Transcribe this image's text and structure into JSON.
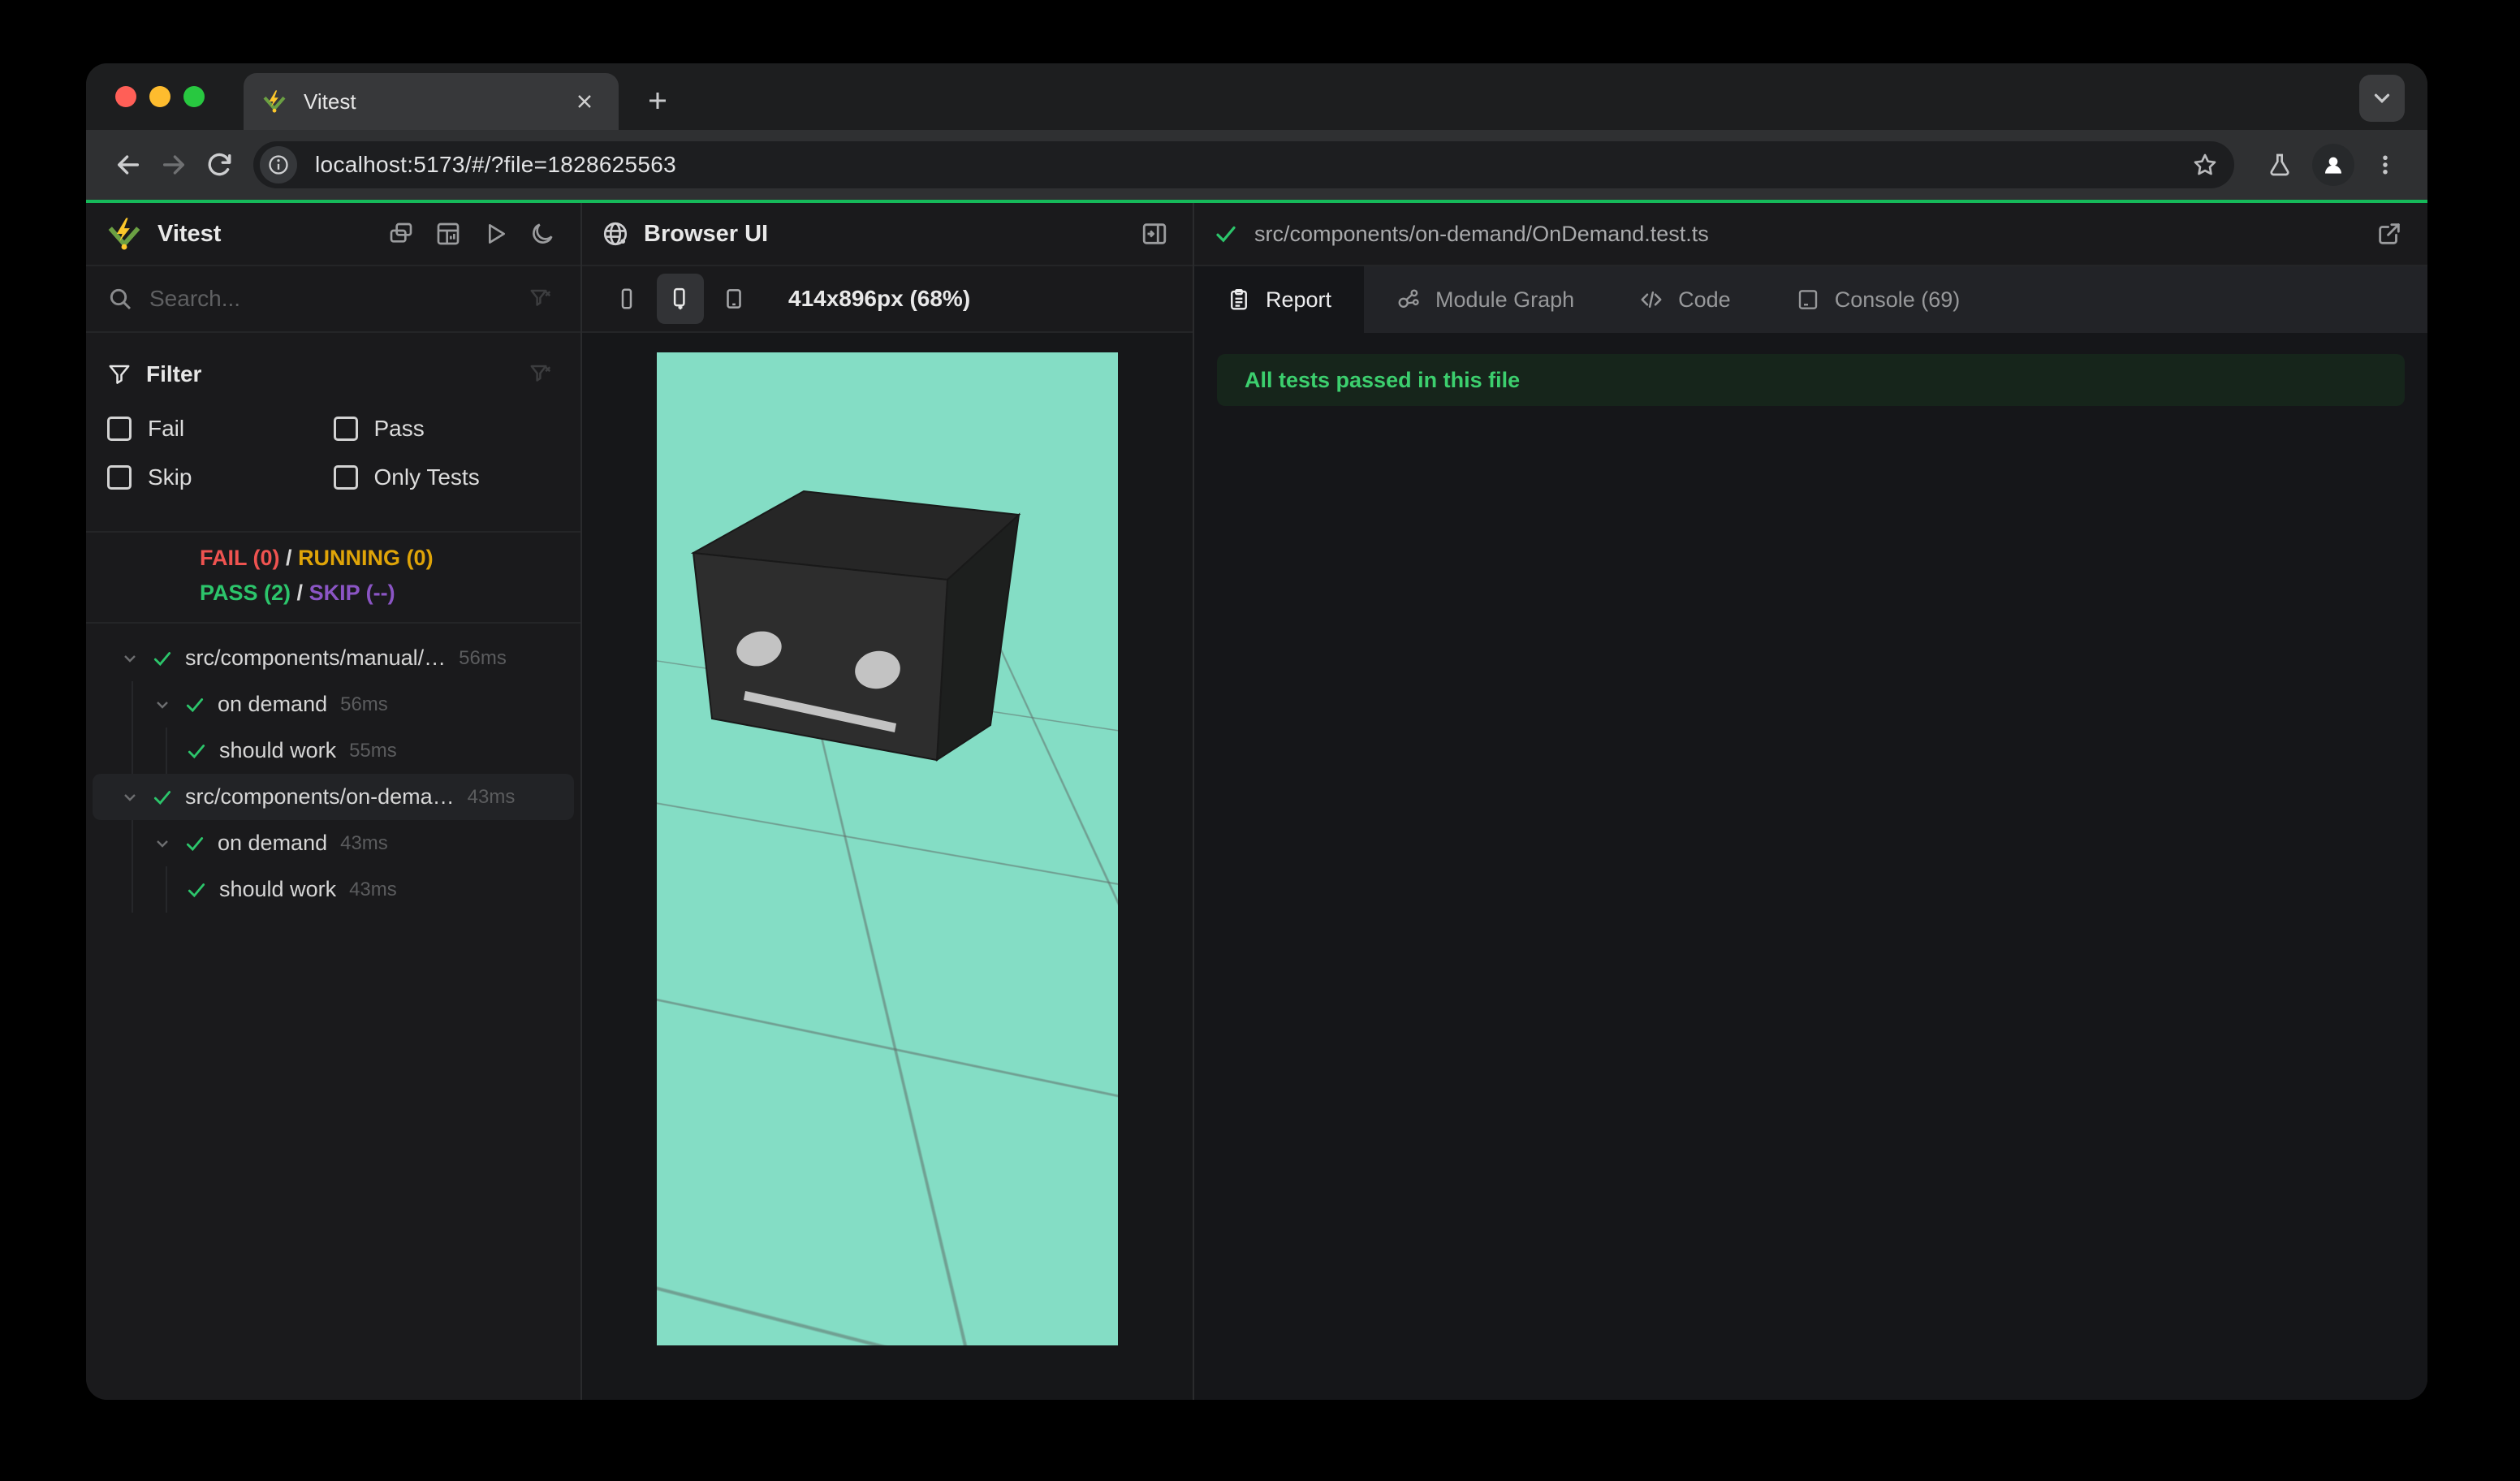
{
  "browser": {
    "tab_title": "Vitest",
    "url": "localhost:5173/#/?file=1828625563"
  },
  "sidebar": {
    "title": "Vitest",
    "search_placeholder": "Search...",
    "filter": {
      "label": "Filter",
      "options": [
        "Fail",
        "Pass",
        "Skip",
        "Only Tests"
      ]
    },
    "status": {
      "fail": "FAIL (0)",
      "running": "RUNNING (0)",
      "pass": "PASS (2)",
      "skip": "SKIP (--)",
      "separator": "/"
    },
    "tree": [
      {
        "name": "src/components/manual/…",
        "duration": "56ms"
      },
      {
        "name": "on demand",
        "duration": "56ms"
      },
      {
        "name": "should work",
        "duration": "55ms"
      },
      {
        "name": "src/components/on-dema…",
        "duration": "43ms"
      },
      {
        "name": "on demand",
        "duration": "43ms"
      },
      {
        "name": "should work",
        "duration": "43ms"
      }
    ]
  },
  "browser_panel": {
    "title": "Browser UI",
    "viewport_label": "414x896px (68%)"
  },
  "report_panel": {
    "file_path": "src/components/on-demand/OnDemand.test.ts",
    "tabs": [
      {
        "label": "Report"
      },
      {
        "label": "Module Graph"
      },
      {
        "label": "Code"
      },
      {
        "label": "Console (69)"
      }
    ],
    "banner": "All tests passed in this file"
  },
  "colors": {
    "accent_green": "#16b95a",
    "pass_green": "#2cc56b",
    "fail_red": "#ef5350",
    "running_yellow": "#dfa408",
    "skip_purple": "#8b55c5",
    "viewport_teal": "#84ddc5",
    "banner_text": "#3ccf6e"
  }
}
